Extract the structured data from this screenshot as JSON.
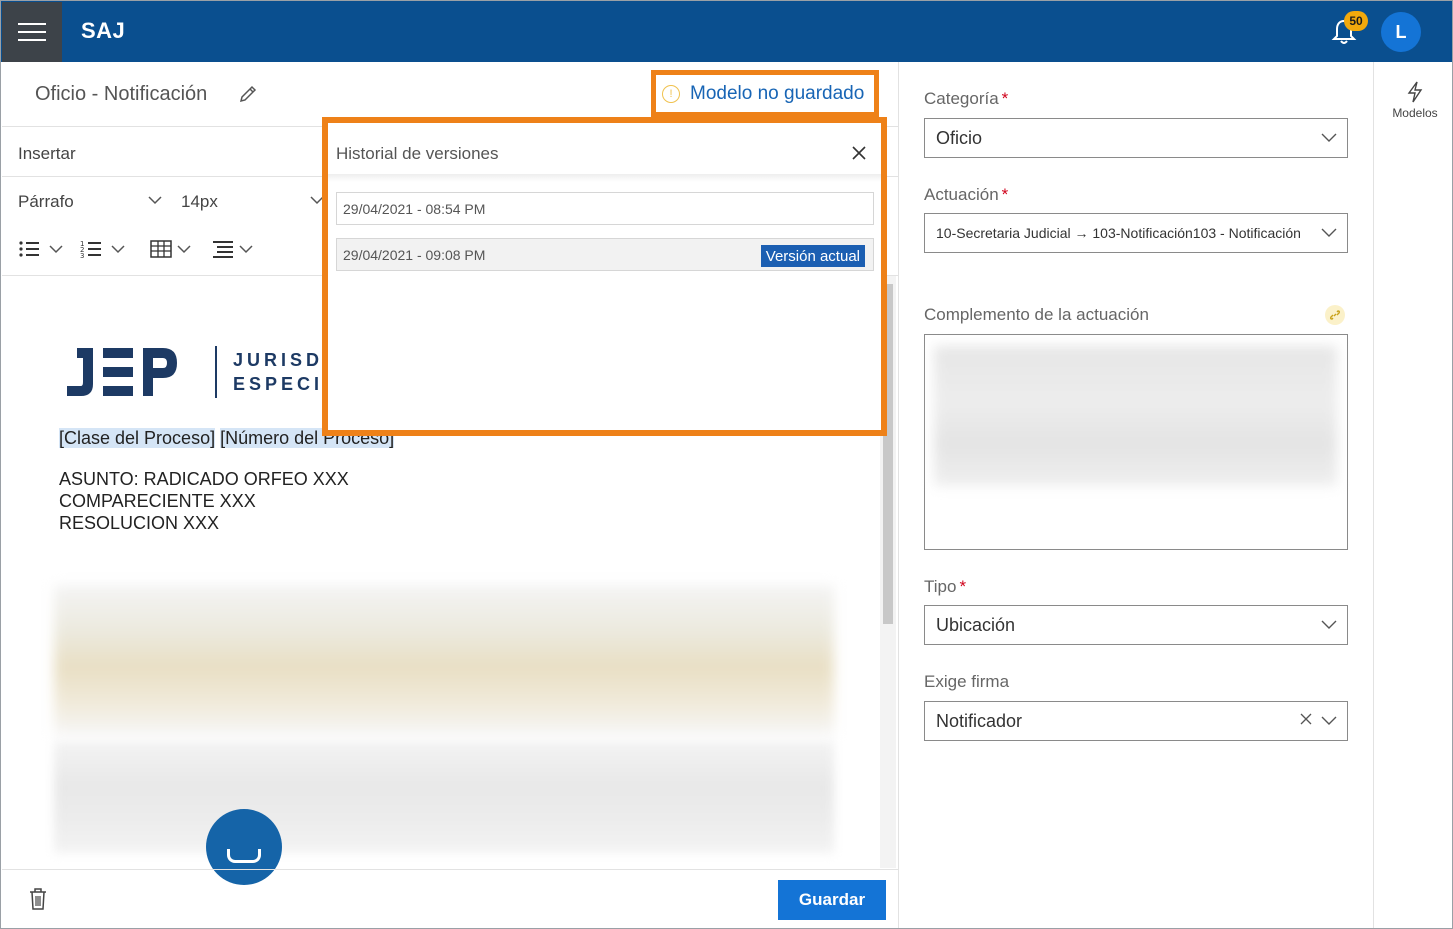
{
  "app": {
    "brand": "SAJ",
    "notifications_count": "50",
    "user_initial": "L"
  },
  "editor": {
    "doc_title": "Oficio - Notificación",
    "unsaved_label": "Modelo no guardado",
    "menu_insert": "Insertar",
    "format_paragraph": "Párrafo",
    "font_size": "14px",
    "logo_line1": "JURISD",
    "logo_line2": "ESPECI",
    "process_class": "[Clase del Proceso]",
    "process_number": "[Número del Proceso]",
    "body_lines": [
      "ASUNTO: RADICADO ORFEO XXX",
      "COMPARECIENTE XXX",
      "RESOLUCION XXX"
    ],
    "save_label": "Guardar"
  },
  "versions": {
    "title": "Historial de versiones",
    "items": [
      {
        "date": "29/04/2021 - 08:54 PM",
        "badge": ""
      },
      {
        "date": "29/04/2021 - 09:08 PM",
        "badge": "Versión actual"
      }
    ]
  },
  "form": {
    "categoria_label": "Categoría",
    "categoria_value": "Oficio",
    "actuacion_label": "Actuación",
    "actuacion_value": "10-Secretaria Judicial → 103-Notificación103 - Notificación",
    "complemento_label": "Complemento de la actuación",
    "tipo_label": "Tipo",
    "tipo_value": "Ubicación",
    "firma_label": "Exige firma",
    "firma_value": "Notificador",
    "required_mark": "*"
  },
  "sidebar": {
    "modelos_label": "Modelos"
  },
  "colors": {
    "topbar": "#0a4f8f",
    "accent": "#1474d6",
    "highlight_border": "#ee8118",
    "badge": "#f2a90c"
  }
}
